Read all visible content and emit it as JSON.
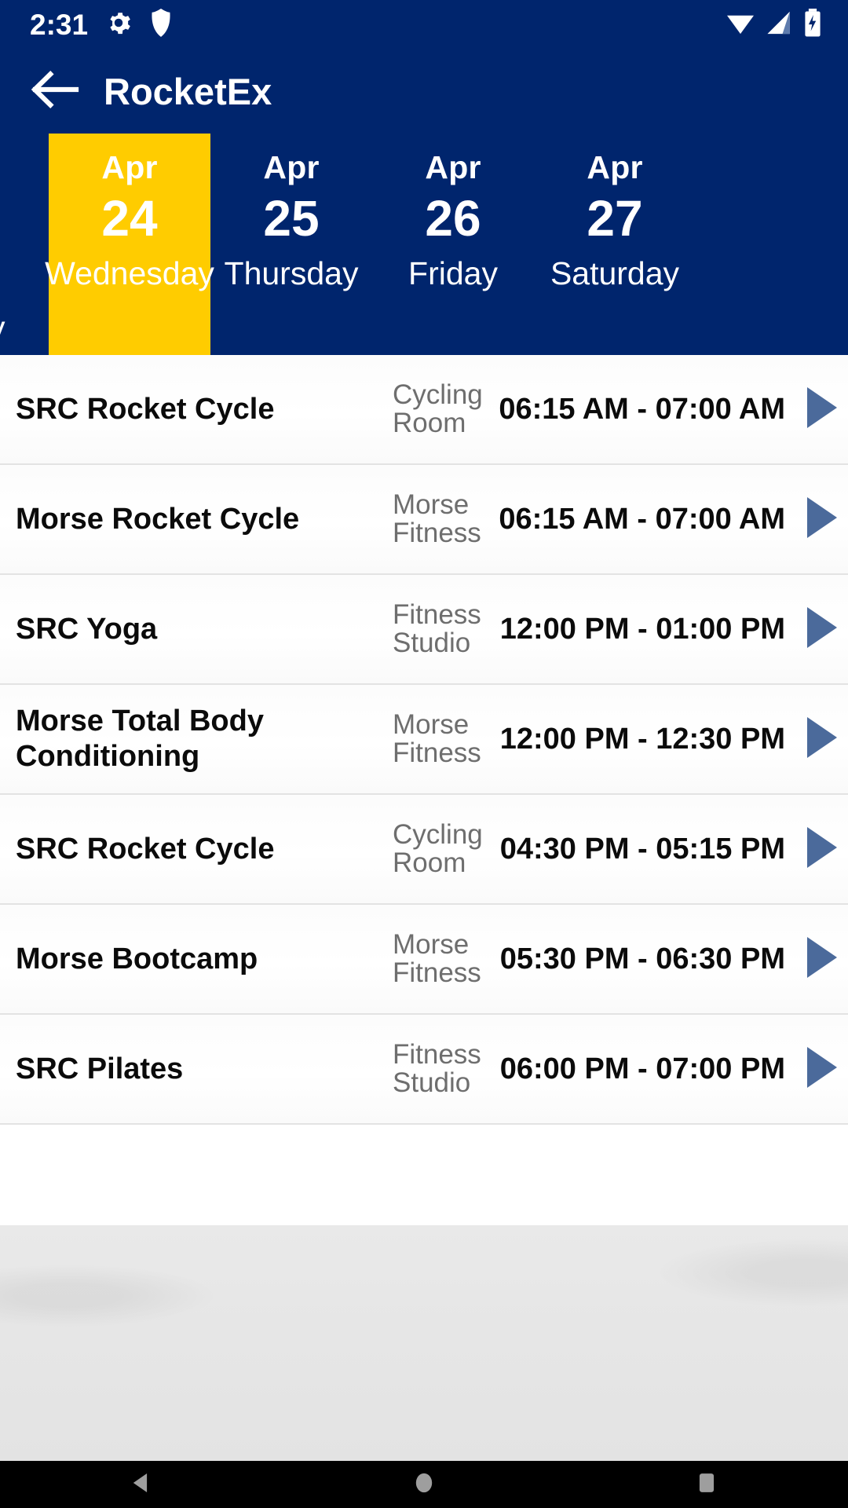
{
  "status_bar": {
    "time": "2:31",
    "icons_left": [
      "gear-icon",
      "shield-icon"
    ],
    "icons_right": [
      "wifi-icon",
      "cellular-signal-icon",
      "battery-charging-icon"
    ]
  },
  "app_bar": {
    "back_icon": "back-arrow-icon",
    "title": "RocketEx"
  },
  "theme": {
    "primary": "#00256D",
    "accent": "#FFCC00",
    "arrow": "#4B6A9B",
    "text_primary": "#0B0B0B",
    "text_secondary": "#6E6E6E"
  },
  "date_tabs": {
    "selected_index": 1,
    "items": [
      {
        "month": "",
        "day": "",
        "weekday": "y",
        "partial": true,
        "selected": false
      },
      {
        "month": "Apr",
        "day": "24",
        "weekday": "Wednesday",
        "partial": false,
        "selected": true
      },
      {
        "month": "Apr",
        "day": "25",
        "weekday": "Thursday",
        "partial": false,
        "selected": false
      },
      {
        "month": "Apr",
        "day": "26",
        "weekday": "Friday",
        "partial": false,
        "selected": false
      },
      {
        "month": "Apr",
        "day": "27",
        "weekday": "Saturday",
        "partial": false,
        "selected": false
      }
    ]
  },
  "schedule": {
    "rows": [
      {
        "name": "SRC Rocket Cycle",
        "location": "Cycling Room",
        "time": "06:15 AM - 07:00 AM",
        "arrow": "play-arrow-icon"
      },
      {
        "name": "Morse Rocket Cycle",
        "location": "Morse Fitness",
        "time": "06:15 AM - 07:00 AM",
        "arrow": "play-arrow-icon"
      },
      {
        "name": "SRC Yoga",
        "location": "Fitness Studio",
        "time": "12:00 PM - 01:00 PM",
        "arrow": "play-arrow-icon"
      },
      {
        "name": "Morse Total Body Conditioning",
        "location": "Morse Fitness",
        "time": "12:00 PM - 12:30 PM",
        "arrow": "play-arrow-icon"
      },
      {
        "name": "SRC Rocket Cycle",
        "location": "Cycling Room",
        "time": "04:30 PM - 05:15 PM",
        "arrow": "play-arrow-icon"
      },
      {
        "name": "Morse Bootcamp",
        "location": "Morse Fitness",
        "time": "05:30 PM - 06:30 PM",
        "arrow": "play-arrow-icon"
      },
      {
        "name": "SRC Pilates",
        "location": "Fitness Studio",
        "time": "06:00 PM - 07:00 PM",
        "arrow": "play-arrow-icon"
      }
    ]
  },
  "nav_bar": {
    "buttons": [
      {
        "name": "back-nav-button",
        "icon": "triangle-back-icon"
      },
      {
        "name": "home-nav-button",
        "icon": "circle-home-icon"
      },
      {
        "name": "recents-nav-button",
        "icon": "square-recents-icon"
      }
    ]
  }
}
